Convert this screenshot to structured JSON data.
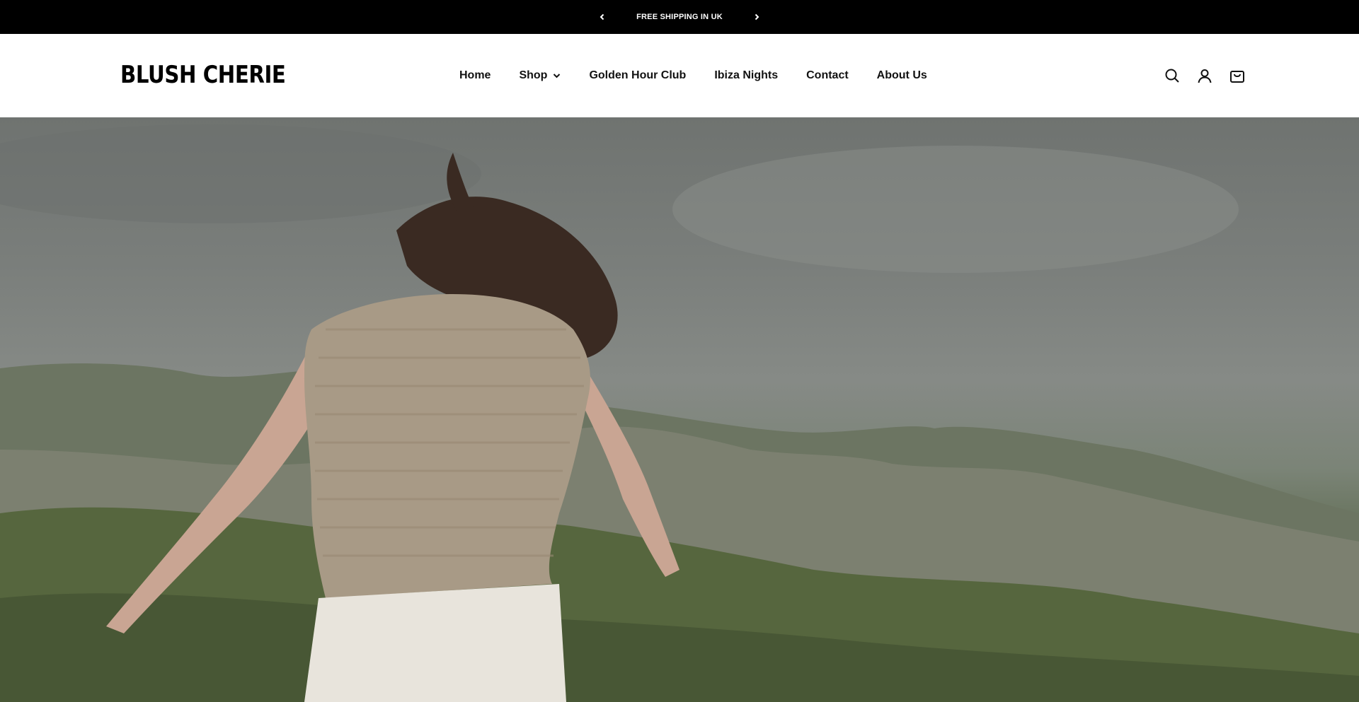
{
  "announcement": {
    "message": "FREE SHIPPING IN UK",
    "prev_icon": "chevron-left-icon",
    "next_icon": "chevron-right-icon"
  },
  "header": {
    "logo_text": "BLUSH CHERIE",
    "nav": [
      {
        "label": "Home"
      },
      {
        "label": "Shop",
        "has_dropdown": true
      },
      {
        "label": "Golden Hour Club"
      },
      {
        "label": "Ibiza Nights"
      },
      {
        "label": "Contact"
      },
      {
        "label": "About Us"
      }
    ],
    "icons": [
      "search-icon",
      "account-icon",
      "cart-icon"
    ]
  },
  "hero": {
    "image": "woman-running-on-mountain-hillside"
  },
  "colors": {
    "announcement_bg": "#000000",
    "header_bg": "#ffffff",
    "text": "#111111"
  }
}
